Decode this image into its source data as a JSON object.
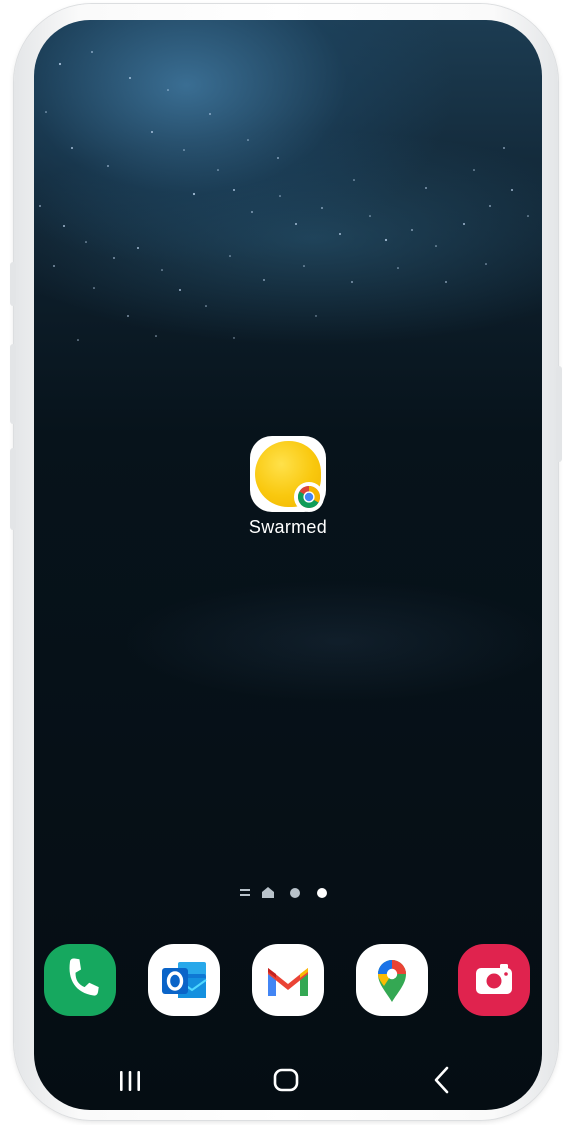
{
  "home": {
    "app": {
      "label": "Swarmed",
      "icon": "swarmed-app-icon",
      "badge_icon": "chrome-badge-icon"
    }
  },
  "pager": {
    "pages": [
      "list",
      "home",
      "page",
      "page"
    ],
    "active_index": 3
  },
  "dock": {
    "apps": [
      {
        "icon": "phone-icon",
        "color": "#16a85f"
      },
      {
        "icon": "outlook-icon",
        "color": "#0a64c8"
      },
      {
        "icon": "gmail-icon",
        "color": "#ea4335"
      },
      {
        "icon": "maps-icon",
        "color": "#34a853"
      },
      {
        "icon": "camera-icon",
        "color": "#e0234e"
      }
    ]
  },
  "nav": {
    "buttons": [
      "recent-apps-icon",
      "home-icon",
      "back-icon"
    ]
  },
  "colors": {
    "app_yellow": "#f9c80e",
    "wallpaper_dark": "#050d13",
    "wallpaper_blue": "#1c3c52"
  }
}
